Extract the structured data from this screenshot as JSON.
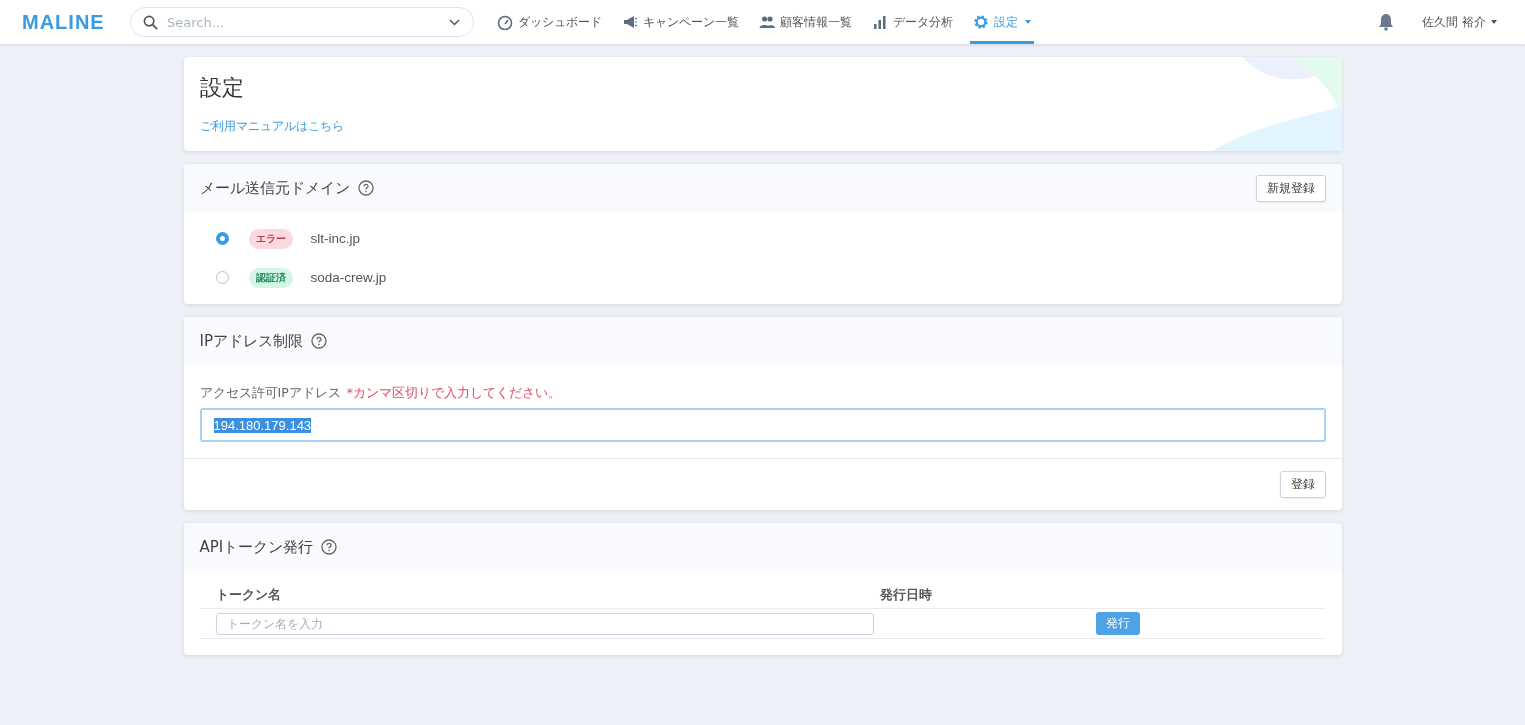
{
  "nav": {
    "logo": "MALINE",
    "search": {
      "placeholder": "Search..."
    },
    "items": [
      {
        "label": "ダッシュボード",
        "selected": false
      },
      {
        "label": "キャンペーン一覧",
        "selected": false
      },
      {
        "label": "顧客情報一覧",
        "selected": false
      },
      {
        "label": "データ分析",
        "selected": false
      },
      {
        "label": "設定",
        "selected": true
      }
    ],
    "user": "佐久間 裕介"
  },
  "page": {
    "title": "設定",
    "manual_link": "ご利用マニュアルはこちら"
  },
  "domains": {
    "title": "メール送信元ドメイン",
    "button": "新規登録",
    "items": [
      {
        "status": "エラー",
        "kind": "error",
        "domain": "slt-inc.jp",
        "selected": true
      },
      {
        "status": "認証済",
        "kind": "verified",
        "domain": "soda-crew.jp",
        "selected": false
      }
    ]
  },
  "ip": {
    "title": "IPアドレス制限",
    "label": "アクセス許可IPアドレス",
    "note": "*カンマ区切りで入力してください。",
    "value": "194.180.179.143",
    "button": "登録"
  },
  "api": {
    "title": "APIトークン発行",
    "columns": [
      "トークン名",
      "発行日時"
    ],
    "placeholder": "トークン名を入力",
    "button": "発行"
  }
}
